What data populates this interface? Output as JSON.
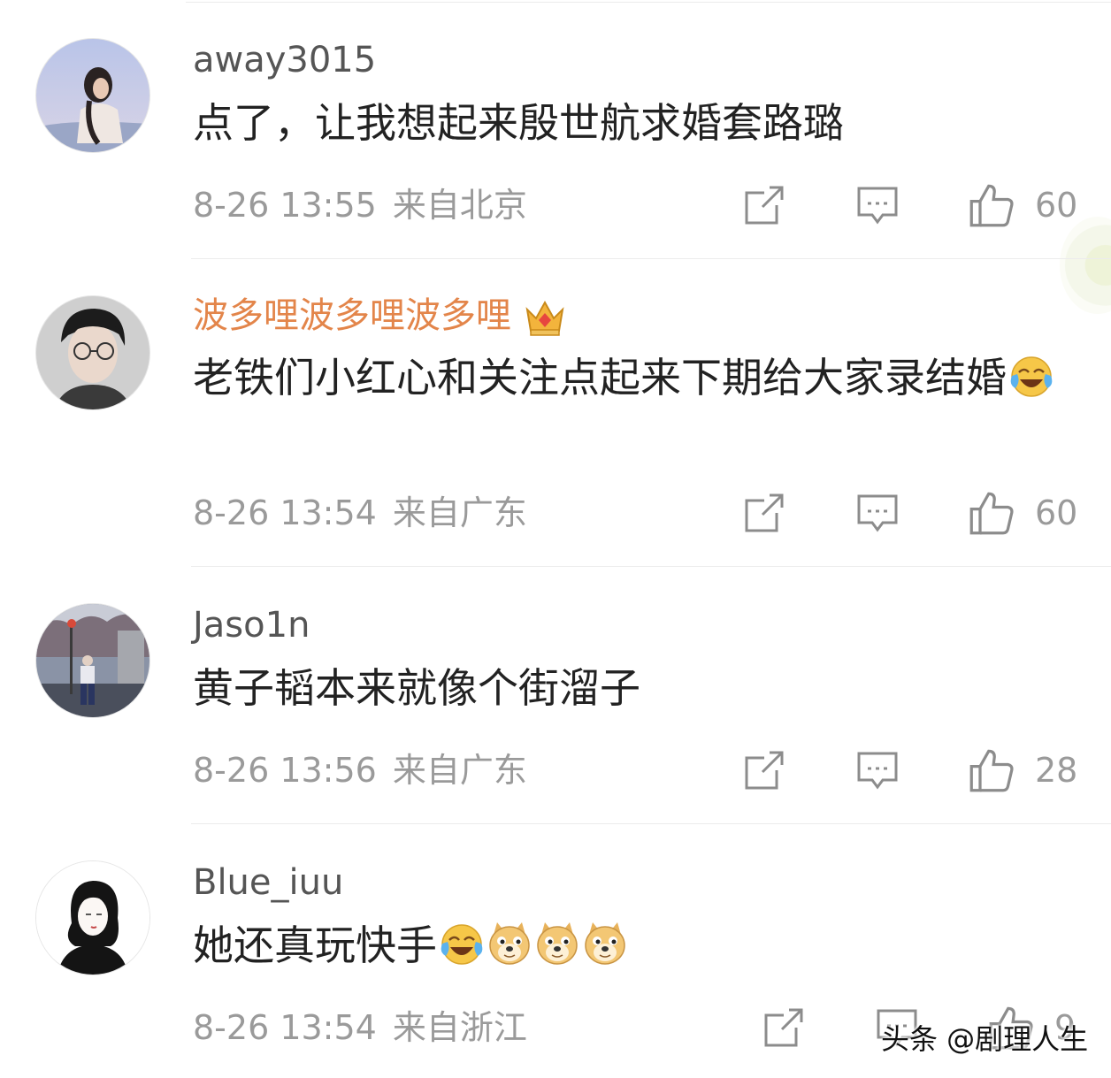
{
  "comments": [
    {
      "username": "away3015",
      "text": "点了，让我想起来殷世航求婚套路璐",
      "emojis": [],
      "time": "8-26 13:55",
      "location": "来自北京",
      "likes": "60",
      "vip": false
    },
    {
      "username": "波多哩波多哩波多哩",
      "text": "老铁们小红心和关注点起来下期给大家录结婚",
      "emojis": [
        "laugh-cry"
      ],
      "time": "8-26 13:54",
      "location": "来自广东",
      "likes": "60",
      "vip": true
    },
    {
      "username": "Jaso1n",
      "text": "黄子韬本来就像个街溜子",
      "emojis": [],
      "time": "8-26 13:56",
      "location": "来自广东",
      "likes": "28",
      "vip": false
    },
    {
      "username": "Blue_iuu",
      "text": "她还真玩快手",
      "emojis": [
        "laugh-cry",
        "doge",
        "doge",
        "doge"
      ],
      "time": "8-26 13:54",
      "location": "来自浙江",
      "likes": "9",
      "vip": false
    }
  ],
  "icons": {
    "share": "share-icon",
    "reply": "comment-icon",
    "like": "thumbs-up-icon",
    "vip": "crown-icon"
  },
  "colors": {
    "vip_name": "#e3854a",
    "meta": "#9a9a9a",
    "text": "#222222"
  },
  "watermark": "头条 @剧理人生"
}
